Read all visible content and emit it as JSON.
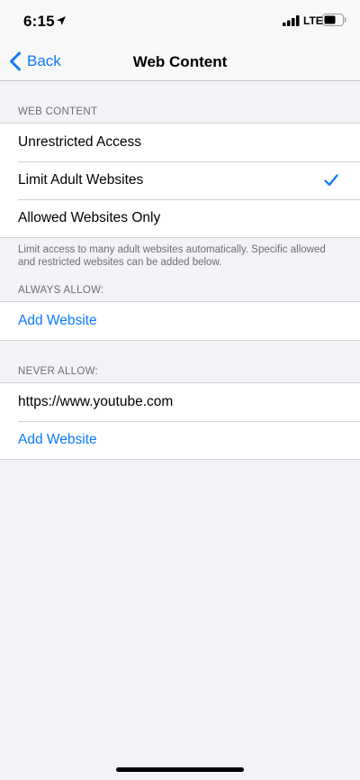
{
  "status_bar": {
    "time": "6:15",
    "network": "LTE",
    "icons": [
      "location-arrow-icon",
      "signal-bars-icon",
      "battery-icon"
    ]
  },
  "nav": {
    "back_label": "Back",
    "title": "Web Content"
  },
  "web_content": {
    "header": "WEB CONTENT",
    "options": [
      {
        "label": "Unrestricted Access",
        "selected": false
      },
      {
        "label": "Limit Adult Websites",
        "selected": true
      },
      {
        "label": "Allowed Websites Only",
        "selected": false
      }
    ],
    "footer": "Limit access to many adult websites automatically. Specific allowed and restricted websites can be added below."
  },
  "always_allow": {
    "header": "ALWAYS ALLOW:",
    "add_label": "Add Website"
  },
  "never_allow": {
    "header": "NEVER ALLOW:",
    "sites": [
      "https://www.youtube.com"
    ],
    "add_label": "Add Website"
  },
  "colors": {
    "accent": "#0a7aff",
    "background": "#f2f2f7",
    "secondary_text": "#6d6d72"
  }
}
